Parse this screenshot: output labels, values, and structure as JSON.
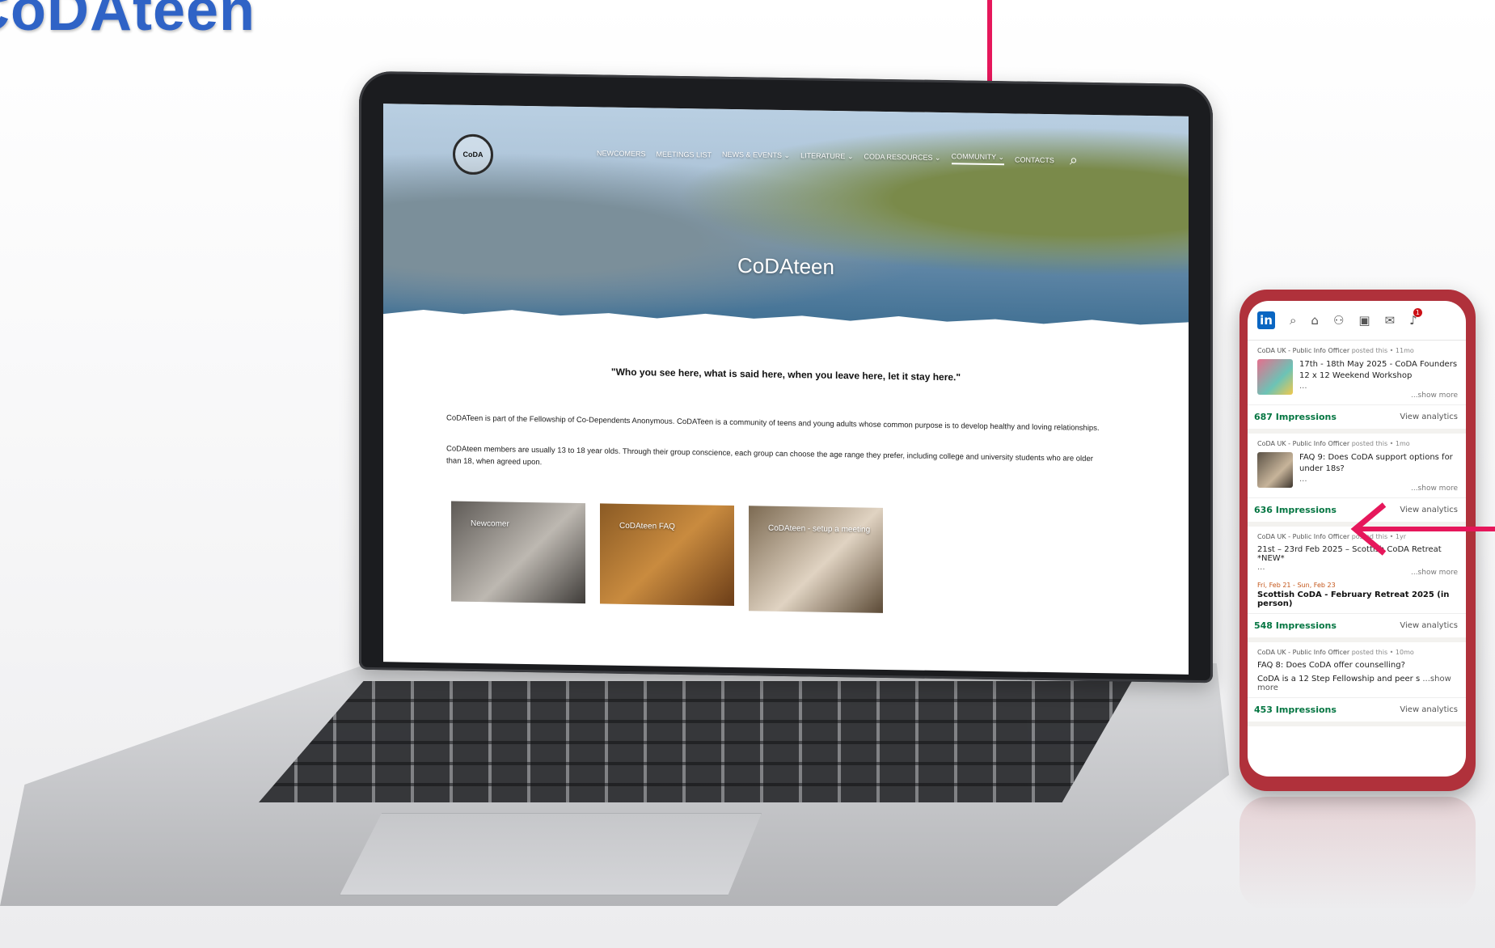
{
  "page": {
    "title": "CoDAteen"
  },
  "colors": {
    "title_blue": "#2f63c6",
    "arrow": "#e6175b",
    "linkedin_blue": "#0a66c2",
    "impressions_green": "#057642",
    "phone_red": "#b0313b"
  },
  "website": {
    "logo_text": "CoDA",
    "nav": [
      "NEWCOMERS",
      "MEETINGS LIST",
      "NEWS & EVENTS",
      "LITERATURE",
      "CODA RESOURCES",
      "COMMUNITY",
      "CONTACTS"
    ],
    "hero_title": "CoDAteen",
    "quote": "\"Who you see here, what is said here, when you leave here, let it stay here.\"",
    "paragraph_1": "CoDATeen is part of the Fellowship of Co-Dependents Anonymous. CoDATeen is a community of teens and young adults whose common purpose is to develop healthy and loving relationships.",
    "paragraph_2": "CoDAteen members are usually 13 to 18 year olds. Through their group conscience, each group can choose the age range they prefer, including college and university students who are older than 18, when agreed upon.",
    "cards": [
      "Newcomer",
      "CoDAteen FAQ",
      "CoDAteen - setup a meeting"
    ]
  },
  "linkedin": {
    "posts": [
      {
        "author": "CoDA UK - Public Info Officer",
        "meta": "posted this • 11mo",
        "text": "17th - 18th May 2025 - CoDA Founders 12 x 12 Weekend Workshop",
        "ellipsis": "...",
        "show_more": "...show more",
        "impressions": "687 Impressions",
        "analytics": "View analytics"
      },
      {
        "author": "CoDA UK - Public Info Officer",
        "meta": "posted this • 1mo",
        "text": "FAQ 9: Does CoDA support options for under 18s?",
        "ellipsis": "...",
        "show_more": "...show more",
        "impressions": "636 Impressions",
        "analytics": "View analytics"
      },
      {
        "author": "CoDA UK - Public Info Officer",
        "meta": "posted this • 1yr",
        "text": "21st – 23rd Feb 2025 – Scottish CoDA Retreat *NEW*",
        "ellipsis": "...",
        "show_more": "...show more",
        "event_date": "Fri, Feb 21 - Sun, Feb 23",
        "event_title": "Scottish CoDA - February Retreat 2025 (in person)",
        "impressions": "548 Impressions",
        "analytics": "View analytics"
      },
      {
        "author": "CoDA UK - Public Info Officer",
        "meta": "posted this • 10mo",
        "text": "FAQ 8: Does CoDA offer counselling?",
        "text_2": "CoDA is a 12 Step Fellowship and peer s",
        "show_more": "...show more",
        "impressions": "453 Impressions",
        "analytics": "View analytics"
      }
    ],
    "notification_count": "1"
  }
}
